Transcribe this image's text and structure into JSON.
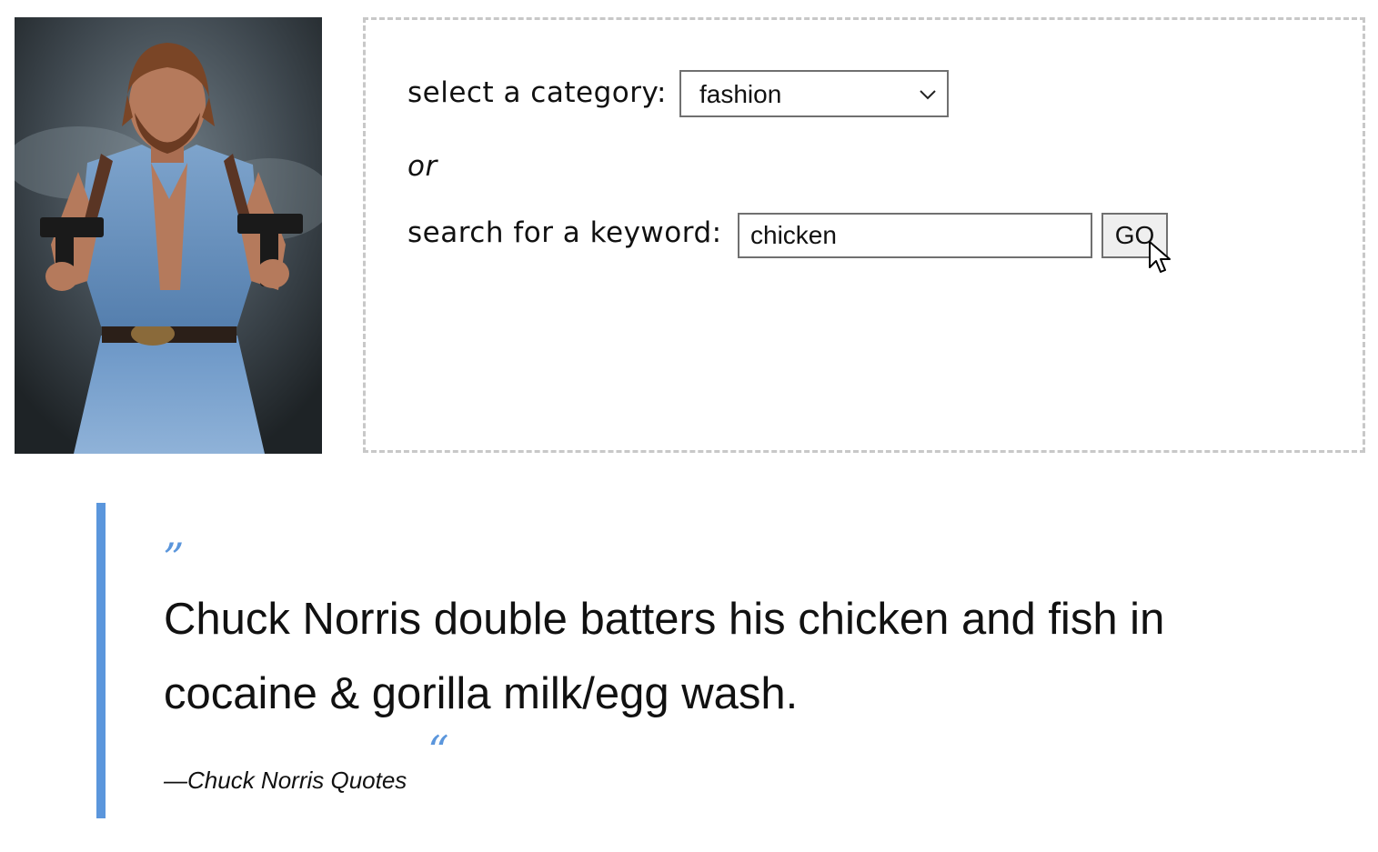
{
  "photo": {
    "subject": "man holding two pistols in denim shirt"
  },
  "search": {
    "category_label": "select a category:",
    "category_selected": "fashion",
    "or_text": "or",
    "keyword_label": "search for a keyword:",
    "keyword_value": "chicken",
    "go_label": "GO"
  },
  "quote": {
    "open_mark": "”",
    "text": "Chuck Norris double batters his chicken and fish in cocaine & gorilla milk/egg wash.",
    "dash": "—",
    "source": "Chuck Norris Quotes",
    "close_mark": "“"
  },
  "colors": {
    "accent": "#5b96dc",
    "panel_border": "#c8c8c8"
  },
  "icons": {
    "select_chevron": "chevron-down-icon",
    "cursor": "mouse-pointer-icon"
  }
}
